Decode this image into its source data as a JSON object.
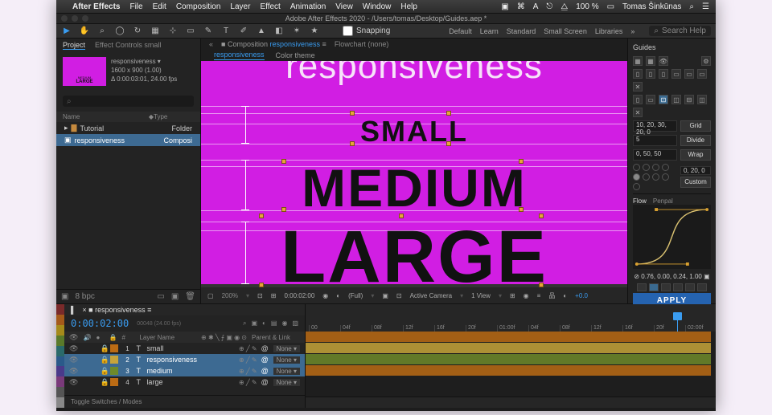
{
  "mac": {
    "app_name": "After Effects",
    "menus": [
      "File",
      "Edit",
      "Composition",
      "Layer",
      "Effect",
      "Animation",
      "View",
      "Window",
      "Help"
    ],
    "battery_pct": "100 %",
    "user": "Tomas Šinkūnas"
  },
  "window": {
    "title": "Adobe After Effects 2020 - /Users/tomas/Desktop/Guides.aep *"
  },
  "toolrow": {
    "snapping_label": "Snapping",
    "workspaces": [
      "Default",
      "Learn",
      "Standard",
      "Small Screen",
      "Libraries"
    ],
    "search_placeholder": "Search Help"
  },
  "project": {
    "tab_project": "Project",
    "tab_effect": "Effect Controls small",
    "sel_name": "responsiveness ▾",
    "sel_res": "1600 x 900 (1.00)",
    "sel_dur": "Δ 0:00:03:01, 24.00 fps",
    "col_name": "Name",
    "col_type": "Type",
    "row_folder": "Tutorial",
    "row_folder_type": "Folder",
    "row_comp": "responsiveness",
    "row_comp_type": "Composi"
  },
  "comp": {
    "panel_label": "Composition",
    "panel_active": "responsiveness",
    "flowchart": "Flowchart (none)",
    "tab1": "responsiveness",
    "tab2": "Color theme",
    "text_top": "responsiveness",
    "text_small": "SMALL",
    "text_med": "MEDIUM",
    "text_large": "LARGE"
  },
  "viewer_footer": {
    "zoom": "200%",
    "time": "0:00:02:00",
    "res": "(Full)",
    "camera": "Active Camera",
    "views": "1 View",
    "exposure": "+0.0"
  },
  "guides_panel": {
    "title": "Guides",
    "val1": "10, 20, 30, 20, 0",
    "btn_grid": "Grid",
    "val2": "5",
    "btn_divide": "Divide",
    "val3": "0, 50, 50",
    "btn_wrap": "Wrap",
    "val4": "0, 20, 0",
    "btn_custom": "Custom"
  },
  "flow": {
    "tab_flow": "Flow",
    "tab_penpal": "Penpal",
    "ease_vals": "0.76, 0.00, 0.24, 1.00",
    "btn_apply": "APPLY"
  },
  "timeline": {
    "comp_tab": "responsiveness",
    "timecode": "0:00:02:00",
    "frame_info": "00048 (24.00 fps)",
    "hdr_source": "Layer Name",
    "hdr_parent": "Parent & Link",
    "toggle_label": "Toggle Switches / Modes",
    "layers": [
      {
        "idx": "1",
        "name": "small",
        "color": "#bb6b14"
      },
      {
        "idx": "2",
        "name": "responsiveness",
        "color": "#c7a43a"
      },
      {
        "idx": "3",
        "name": "medium",
        "color": "#6e8a2a"
      },
      {
        "idx": "4",
        "name": "large",
        "color": "#bb6b14"
      }
    ],
    "none_label": "None",
    "ruler_ticks": [
      "00",
      "04f",
      "08f",
      "12f",
      "16f",
      "20f",
      "01:00f",
      "04f",
      "08f",
      "12f",
      "16f",
      "20f",
      "02:00f"
    ]
  }
}
